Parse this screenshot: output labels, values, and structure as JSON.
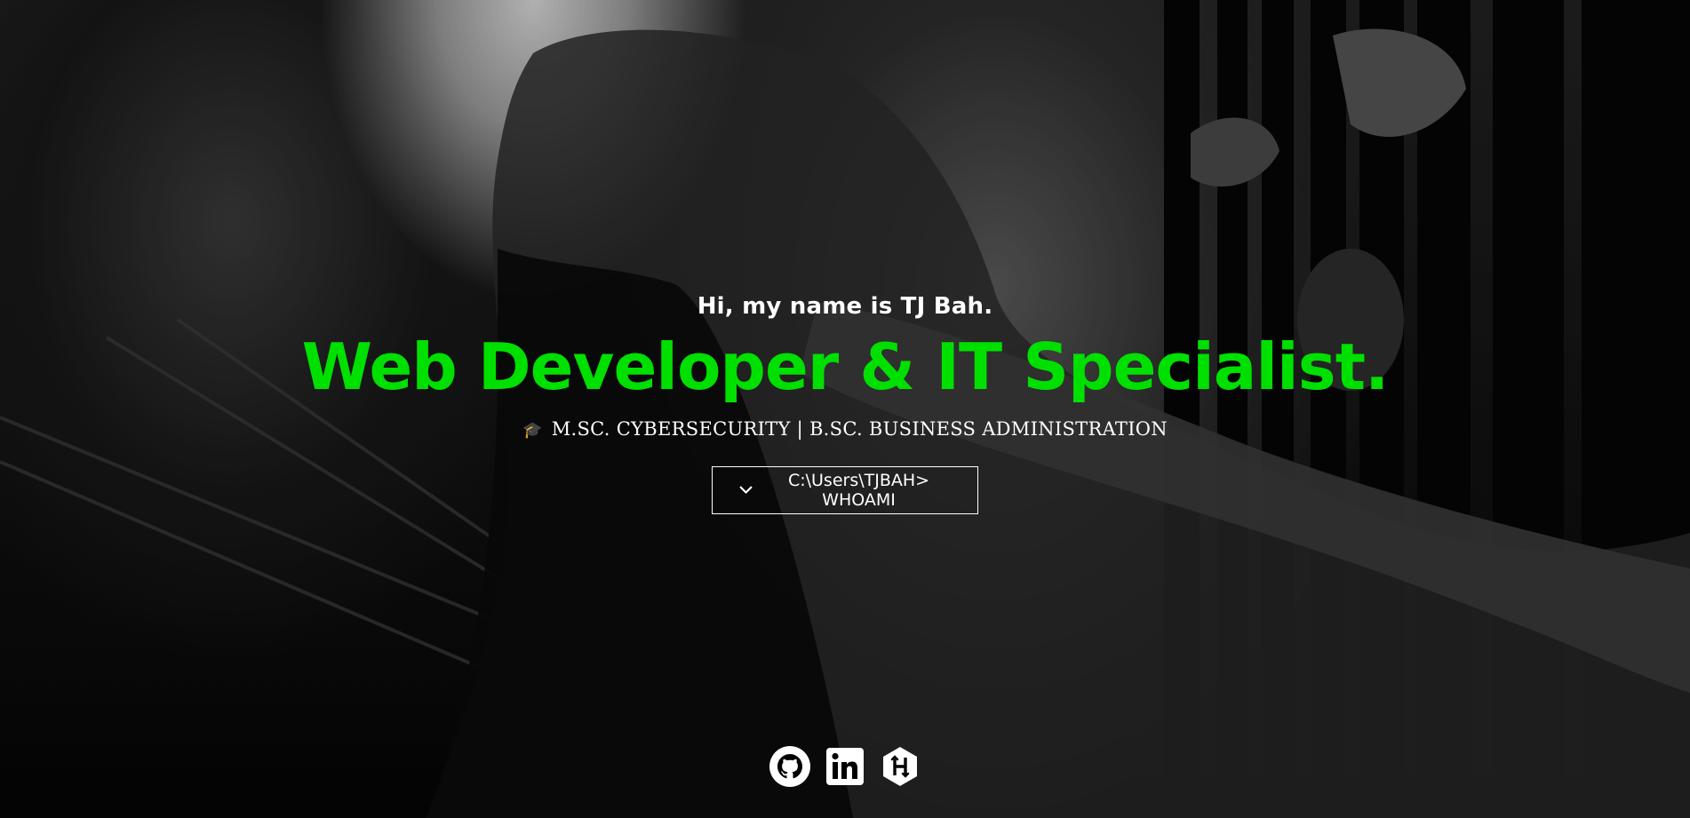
{
  "hero": {
    "greeting": "Hi, my name is TJ Bah.",
    "headline": "Web Developer & IT Specialist.",
    "degrees": "M.SC. CYBERSECURITY | B.SC. BUSINESS ADMINISTRATION",
    "degrees_icon": "graduation-cap-icon",
    "cta_label": "C:\\Users\\TJBAH> WHOAMI",
    "cta_icon": "chevron-down-icon"
  },
  "socials": [
    {
      "name": "GitHub",
      "icon": "github-icon"
    },
    {
      "name": "LinkedIn",
      "icon": "linkedin-icon"
    },
    {
      "name": "Hackerrank",
      "icon": "hackerrank-icon"
    }
  ],
  "colors": {
    "accent": "#00e000",
    "text": "#ffffff",
    "background": "#000000"
  }
}
